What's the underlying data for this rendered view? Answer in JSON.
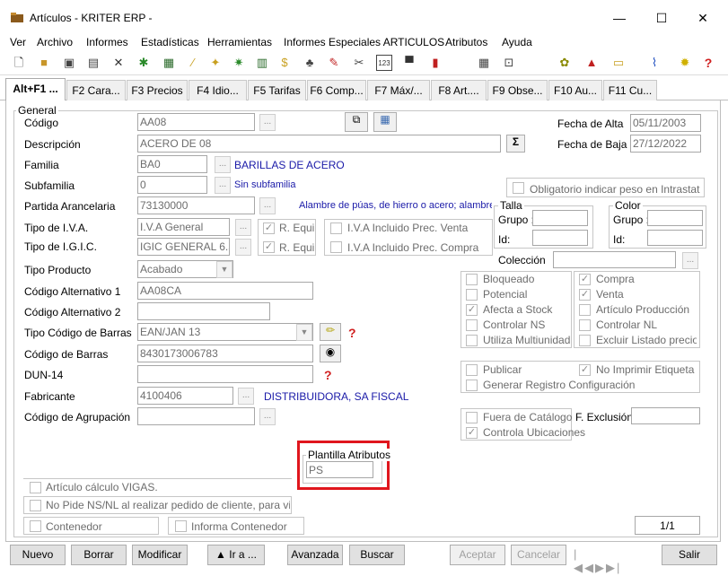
{
  "window": {
    "title": "Artículos - KRITER ERP -",
    "minimize_glyph": "—",
    "maximize_glyph": "☐",
    "close_glyph": "✕"
  },
  "menu": [
    "Ver",
    "Archivo",
    "Informes",
    "Estadísticas",
    "Herramientas",
    "Informes Especiales ARTICULOS",
    "Atributos",
    "Ayuda"
  ],
  "tabs": [
    "Alt+F1 ...",
    "F2 Cara...",
    "F3 Precios",
    "F4 Idio...",
    "F5 Tarifas",
    "F6 Comp...",
    "F7 Máx/...",
    "F8 Art....",
    "F9 Obse...",
    "F10 Au...",
    "F11 Cu..."
  ],
  "icons": {
    "new": "new-document-icon",
    "open": "open-folder-icon",
    "save": "save-icon",
    "cut": "cut-icon",
    "close": "close-icon",
    "chart": "bar-chart-icon",
    "cart": "cart-icon",
    "clip": "paperclip-icon",
    "bulb": "lightbulb-icon",
    "help": "help-icon"
  },
  "form": {
    "group_title": "General",
    "codigo": {
      "label": "Código",
      "value": "AA08"
    },
    "descripcion": {
      "label": "Descripción",
      "value": "ACERO DE 08"
    },
    "familia": {
      "label": "Familia",
      "value": "BA0",
      "desc": "BARILLAS DE ACERO"
    },
    "subfamilia": {
      "label": "Subfamilia",
      "value": "0",
      "desc": "Sin subfamilia"
    },
    "partida": {
      "label": "Partida Arancelaria",
      "value": "73130000",
      "desc": "Alambre de púas, de hierro o acero; alambre ("
    },
    "iva": {
      "label": "Tipo de I.V.A.",
      "value": "I.V.A General",
      "requi": "R. Equi",
      "incluido": "I.V.A Incluido Prec. Venta"
    },
    "igic": {
      "label": "Tipo de I.G.I.C.",
      "value": "IGIC GENERAL 6.5",
      "requi": "R. Equi",
      "incluido": "I.V.A Incluido Prec. Compra"
    },
    "tipo_producto": {
      "label": "Tipo Producto",
      "value": "Acabado"
    },
    "cod_alt1": {
      "label": "Código Alternativo 1",
      "value": "AA08CA"
    },
    "cod_alt2": {
      "label": "Código Alternativo 2",
      "value": ""
    },
    "tipo_cod_barras": {
      "label": "Tipo Código de Barras",
      "value": "EAN/JAN 13"
    },
    "cod_barras": {
      "label": "Código de Barras",
      "value": "8430173006783"
    },
    "dun14": {
      "label": "DUN-14",
      "value": ""
    },
    "fabricante": {
      "label": "Fabricante",
      "value": "4100406",
      "desc": "DISTRIBUIDORA, SA FISCAL"
    },
    "cod_agrupacion": {
      "label": "Código de Agrupación",
      "value": ""
    },
    "fecha_alta": {
      "label": "Fecha de Alta",
      "value": "05/11/2003"
    },
    "fecha_baja": {
      "label": "Fecha de Baja",
      "value": "27/12/2022"
    },
    "obligatorio_peso": "Obligatorio indicar peso en Intrastat",
    "talla": {
      "title": "Talla",
      "grupo": "Grupo :",
      "id": "Id:"
    },
    "color": {
      "title": "Color",
      "grupo": "Grupo :",
      "id": "Id:"
    },
    "coleccion": {
      "label": "Colección",
      "value": ""
    },
    "checks_left": [
      "Bloqueado",
      "Potencial",
      "Afecta a Stock",
      "Controlar NS",
      "Utiliza Multiunidad"
    ],
    "checks_right": [
      "Compra",
      "Venta",
      "Artículo Producción",
      "Controlar NL",
      "Excluir Listado precio n"
    ],
    "publicar": "Publicar",
    "no_imprimir": "No Imprimir Etiqueta",
    "gen_registro": "Generar Registro Configuración",
    "fuera_catalogo": "Fuera de Catálogo",
    "f_exclusion": {
      "label": "F. Exclusión",
      "value": ""
    },
    "controla_ubic": "Controla Ubicaciones",
    "plantilla": {
      "label": "Plantilla Atributos",
      "value": "PS"
    },
    "vigas": "Artículo cálculo VIGAS.",
    "no_pide": "No Pide NS/NL al realizar pedido de cliente, para vincula",
    "contenedor": "Contenedor",
    "informa_contenedor": "Informa Contenedor",
    "record": "1/1",
    "ellipsis": "...",
    "sigma": "Σ"
  },
  "buttons": {
    "nuevo": "Nuevo",
    "borrar": "Borrar",
    "modificar": "Modificar",
    "ira": "▲ Ir a ...",
    "avanzada": "Avanzada",
    "buscar": "Buscar",
    "aceptar": "Aceptar",
    "cancelar": "Cancelar",
    "salir": "Salir"
  },
  "colors": {
    "highlight": "#e0161d",
    "link": "#1a1aa8"
  }
}
